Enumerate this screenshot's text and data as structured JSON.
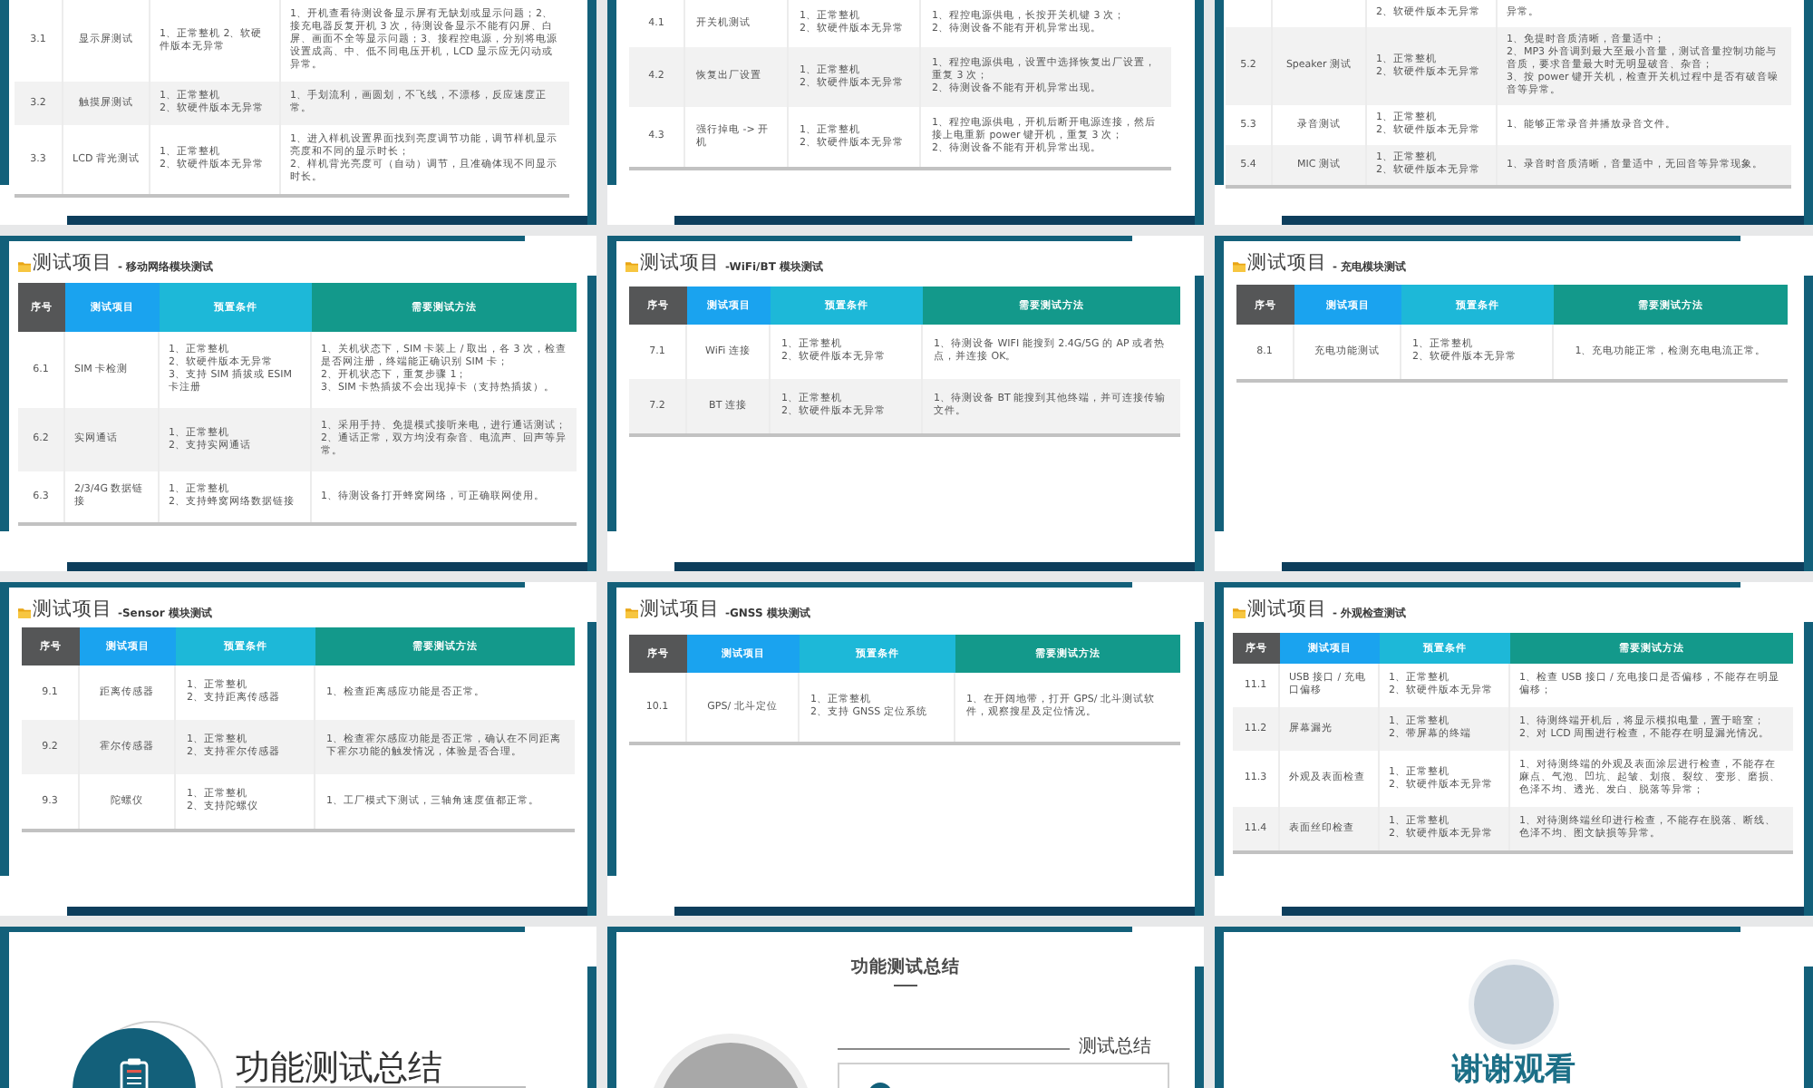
{
  "slides": [
    {
      "kind": "table",
      "rows": [
        {
          "no": "3.1",
          "item": "显示屏测试",
          "preconditions": [
            "1、正常整机 2、软硬件版本无异常"
          ],
          "method": [
            "1、开机查看待测设备显示屏有无缺划或显示问题；2、接充电器反复开机 3 次，待测设备显示不能有闪屏、白屏、画面不全等显示问题；3、接程控电源，分别将电源设置成高、中、低不同电压开机，LCD 显示应无闪动或异常。"
          ]
        },
        {
          "no": "3.2",
          "item": "触摸屏测试",
          "preconditions": [
            "1、正常整机",
            "2、软硬件版本无异常"
          ],
          "method": [
            "1、手划流利，画圆划，不飞线，不漂移，反应速度正常。"
          ]
        },
        {
          "no": "3.3",
          "item": "LCD 背光测试",
          "preconditions": [
            "1、正常整机",
            "2、软硬件版本无异常"
          ],
          "method": [
            "1、进入样机设置界面找到亮度调节功能，调节样机显示亮度和不同的显示时长；",
            "2、样机背光亮度可（自动）调节，且准确体现不同显示时长。"
          ]
        }
      ]
    },
    {
      "kind": "table",
      "rows": [
        {
          "no": "4.1",
          "item": "开关机测试",
          "preconditions": [
            "1、正常整机",
            "2、软硬件版本无异常"
          ],
          "method": [
            "1、程控电源供电，长按开关机键 3 次；",
            "2、待测设备不能有开机异常出现。"
          ]
        },
        {
          "no": "4.2",
          "item": "恢复出厂设置",
          "preconditions": [
            "1、正常整机",
            "2、软硬件版本无异常"
          ],
          "method": [
            "1、程控电源供电，设置中选择恢复出厂设置，重复 3 次；",
            "2、待测设备不能有开机异常出现。"
          ]
        },
        {
          "no": "4.3",
          "item": "强行掉电 -> 开机",
          "preconditions": [
            "1、正常整机",
            "2、软硬件版本无异常"
          ],
          "method": [
            "1、程控电源供电，开机后断开电源连接，然后接上电重新 power 键开机，重复 3 次；",
            "2、待测设备不能有开机异常出现。"
          ]
        }
      ]
    },
    {
      "kind": "table",
      "rows": [
        {
          "preconditions": [
            "2、软硬件版本无异常"
          ],
          "method": [
            "异常。"
          ]
        },
        {
          "no": "5.2",
          "item": "Speaker 测试",
          "preconditions": [
            "1、正常整机",
            "2、软硬件版本无异常"
          ],
          "method": [
            "1、免提时音质清晰，音量适中；",
            "2、MP3 外音调到最大至最小音量，测试音量控制功能与音质，要求音量最大时无明显破音、杂音；",
            "3、按 power 键开关机，检查开关机过程中是否有破音噪音等异常。"
          ]
        },
        {
          "no": "5.3",
          "item": "录音测试",
          "preconditions": [
            "1、正常整机",
            "2、软硬件版本无异常"
          ],
          "method": [
            "1、能够正常录音并播放录音文件。"
          ]
        },
        {
          "no": "5.4",
          "item": "MIC 测试",
          "preconditions": [
            "1、正常整机",
            "2、软硬件版本无异常"
          ],
          "method": [
            "1、录音时音质清晰，音量适中，无回音等异常现象。"
          ]
        }
      ]
    },
    {
      "kind": "table",
      "title": "测试项目",
      "subtitle": "- 移动网络模块测试",
      "columns": [
        "序号",
        "测试项目",
        "预置条件",
        "需要测试方法"
      ],
      "rows": [
        {
          "no": "6.1",
          "item": "SIM 卡检测",
          "preconditions": [
            "1、正常整机",
            "2、软硬件版本无异常",
            "3、支持 SIM 插拔或 ESIM 卡注册"
          ],
          "method": [
            "1、关机状态下，SIM 卡装上 / 取出，各 3 次，检查是否网注册，终端能正确识别 SIM 卡；",
            "2、开机状态下，重复步骤 1；",
            "3、SIM 卡热插拔不会出现掉卡（支持热插拔）。"
          ]
        },
        {
          "no": "6.2",
          "item": "实网通话",
          "preconditions": [
            "1、正常整机",
            "2、支持实网通话"
          ],
          "method": [
            "1、采用手持、免提模式接听来电，进行通话测试；",
            "2、通话正常，双方均没有杂音、电流声、回声等异常。"
          ]
        },
        {
          "no": "6.3",
          "item": "2/3/4G 数据链接",
          "preconditions": [
            "1、正常整机",
            "2、支持蜂窝网络数据链接"
          ],
          "method": [
            "1、待测设备打开蜂窝网络，可正确联网使用。"
          ]
        }
      ]
    },
    {
      "kind": "table",
      "title": "测试项目",
      "subtitle": "-WiFi/BT 模块测试",
      "columns": [
        "序号",
        "测试项目",
        "预置条件",
        "需要测试方法"
      ],
      "rows": [
        {
          "no": "7.1",
          "item": "WiFi 连接",
          "preconditions": [
            "1、正常整机",
            "2、软硬件版本无异常"
          ],
          "method": [
            "1、待测设备 WIFI 能搜到 2.4G/5G 的 AP 或者热点，并连接 OK。"
          ]
        },
        {
          "no": "7.2",
          "item": "BT 连接",
          "preconditions": [
            "1、正常整机",
            "2、软硬件版本无异常"
          ],
          "method": [
            "1、待测设备 BT 能搜到其他终端，并可连接传输文件。"
          ]
        }
      ]
    },
    {
      "kind": "table",
      "title": "测试项目",
      "subtitle": "- 充电模块测试",
      "columns": [
        "序号",
        "测试项目",
        "预置条件",
        "需要测试方法"
      ],
      "rows": [
        {
          "no": "8.1",
          "item": "充电功能测试",
          "preconditions": [
            "1、正常整机",
            "2、软硬件版本无异常"
          ],
          "method": [
            "1、充电功能正常，检测充电电流正常。"
          ]
        }
      ]
    },
    {
      "kind": "table",
      "title": "测试项目",
      "subtitle": "-Sensor 模块测试",
      "columns": [
        "序号",
        "测试项目",
        "预置条件",
        "需要测试方法"
      ],
      "rows": [
        {
          "no": "9.1",
          "item": "距离传感器",
          "preconditions": [
            "1、正常整机",
            "2、支持距离传感器"
          ],
          "method": [
            "1、检查距离感应功能是否正常。"
          ]
        },
        {
          "no": "9.2",
          "item": "霍尔传感器",
          "preconditions": [
            "1、正常整机",
            "2、支持霍尔传感器"
          ],
          "method": [
            "1、检查霍尔感应功能是否正常，确认在不同距离下霍尔功能的触发情况，体验是否合理。"
          ]
        },
        {
          "no": "9.3",
          "item": "陀螺仪",
          "preconditions": [
            "1、正常整机",
            "2、支持陀螺仪"
          ],
          "method": [
            "1、工厂模式下测试，三轴角速度值都正常。"
          ]
        }
      ]
    },
    {
      "kind": "table",
      "title": "测试项目",
      "subtitle": "-GNSS 模块测试",
      "columns": [
        "序号",
        "测试项目",
        "预置条件",
        "需要测试方法"
      ],
      "rows": [
        {
          "no": "10.1",
          "item": "GPS/ 北斗定位",
          "preconditions": [
            "1、正常整机",
            "2、支持 GNSS 定位系统"
          ],
          "method": [
            "1、在开阔地带，打开 GPS/ 北斗测试软件，观察搜星及定位情况。"
          ]
        }
      ]
    },
    {
      "kind": "table",
      "title": "测试项目",
      "subtitle": "- 外观检查测试",
      "columns": [
        "序号",
        "测试项目",
        "预置条件",
        "需要测试方法"
      ],
      "rows": [
        {
          "no": "11.1",
          "item": "USB 接口 / 充电口偏移",
          "preconditions": [
            "1、正常整机",
            "2、软硬件版本无异常"
          ],
          "method": [
            "1、检查 USB 接口 / 充电接口是否偏移，不能存在明显偏移；"
          ]
        },
        {
          "no": "11.2",
          "item": "屏幕漏光",
          "preconditions": [
            "1、正常整机",
            "2、带屏幕的终端"
          ],
          "method": [
            "1、待测终端开机后，将显示模拟电量，置于暗室；",
            "2、对 LCD 周围进行检查，不能存在明显漏光情况。"
          ]
        },
        {
          "no": "11.3",
          "item": "外观及表面检查",
          "preconditions": [
            "1、正常整机",
            "2、软硬件版本无异常"
          ],
          "method": [
            "1、对待测终端的外观及表面涂层进行检查，不能存在麻点、气泡、凹坑、起皱、划痕、裂纹、变形、磨损、色泽不均、透光、发白、脱落等异常；"
          ]
        },
        {
          "no": "11.4",
          "item": "表面丝印检查",
          "preconditions": [
            "1、正常整机",
            "2、软硬件版本无异常"
          ],
          "method": [
            "1、对待测终端丝印进行检查，不能存在脱落、断线、色泽不均、图文缺损等异常。"
          ]
        }
      ]
    },
    {
      "kind": "section_cover",
      "title": "功能测试总结"
    },
    {
      "kind": "summary",
      "heading": "功能测试总结",
      "label": "测试总结"
    },
    {
      "kind": "closing",
      "title": "谢谢观看"
    }
  ]
}
